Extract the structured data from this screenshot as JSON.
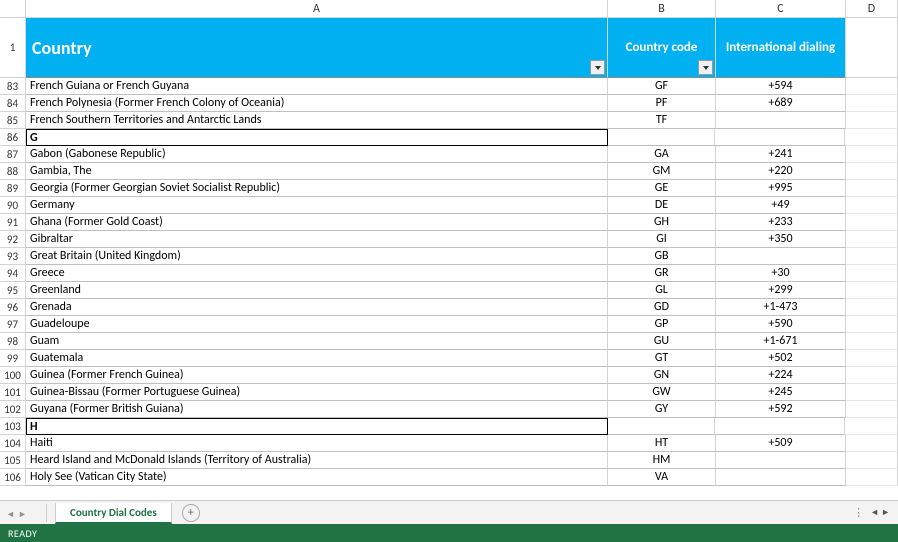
{
  "columns": [
    "A",
    "B",
    "C",
    "D"
  ],
  "header": {
    "row_number": "1",
    "country": "Country",
    "code": "Country code",
    "dialing": "International dialing"
  },
  "rows": [
    {
      "n": "83",
      "country": "French Guiana or French Guyana",
      "code": "GF",
      "dial": "+594"
    },
    {
      "n": "84",
      "country": "French Polynesia (Former French Colony of Oceania)",
      "code": "PF",
      "dial": "+689"
    },
    {
      "n": "85",
      "country": "French Southern Territories and Antarctic Lands",
      "code": "TF",
      "dial": ""
    },
    {
      "n": "86",
      "country": "G",
      "code": "",
      "dial": "",
      "section": true
    },
    {
      "n": "87",
      "country": "Gabon (Gabonese Republic)",
      "code": "GA",
      "dial": "+241"
    },
    {
      "n": "88",
      "country": "Gambia, The",
      "code": "GM",
      "dial": "+220"
    },
    {
      "n": "89",
      "country": "Georgia (Former Georgian Soviet Socialist Republic)",
      "code": "GE",
      "dial": "+995"
    },
    {
      "n": "90",
      "country": "Germany",
      "code": "DE",
      "dial": "+49"
    },
    {
      "n": "91",
      "country": "Ghana (Former Gold Coast)",
      "code": "GH",
      "dial": "+233"
    },
    {
      "n": "92",
      "country": "Gibraltar",
      "code": "GI",
      "dial": "+350"
    },
    {
      "n": "93",
      "country": "Great Britain (United Kingdom)",
      "code": "GB",
      "dial": ""
    },
    {
      "n": "94",
      "country": "Greece",
      "code": "GR",
      "dial": "+30"
    },
    {
      "n": "95",
      "country": "Greenland",
      "code": "GL",
      "dial": "+299"
    },
    {
      "n": "96",
      "country": "Grenada",
      "code": "GD",
      "dial": "+1-473"
    },
    {
      "n": "97",
      "country": "Guadeloupe",
      "code": "GP",
      "dial": "+590"
    },
    {
      "n": "98",
      "country": "Guam",
      "code": "GU",
      "dial": "+1-671"
    },
    {
      "n": "99",
      "country": "Guatemala",
      "code": "GT",
      "dial": "+502"
    },
    {
      "n": "100",
      "country": "Guinea (Former French Guinea)",
      "code": "GN",
      "dial": "+224"
    },
    {
      "n": "101",
      "country": "Guinea-Bissau (Former Portuguese Guinea)",
      "code": "GW",
      "dial": "+245"
    },
    {
      "n": "102",
      "country": "Guyana (Former British Guiana)",
      "code": "GY",
      "dial": "+592"
    },
    {
      "n": "103",
      "country": "H",
      "code": "",
      "dial": "",
      "section": true
    },
    {
      "n": "104",
      "country": "Haiti",
      "code": "HT",
      "dial": "+509"
    },
    {
      "n": "105",
      "country": "Heard Island and McDonald Islands (Territory of Australia)",
      "code": "HM",
      "dial": ""
    },
    {
      "n": "106",
      "country": "Holy See (Vatican City State)",
      "code": "VA",
      "dial": ""
    }
  ],
  "tabs": {
    "active": "Country Dial Codes",
    "new_label": "+"
  },
  "status": "READY"
}
